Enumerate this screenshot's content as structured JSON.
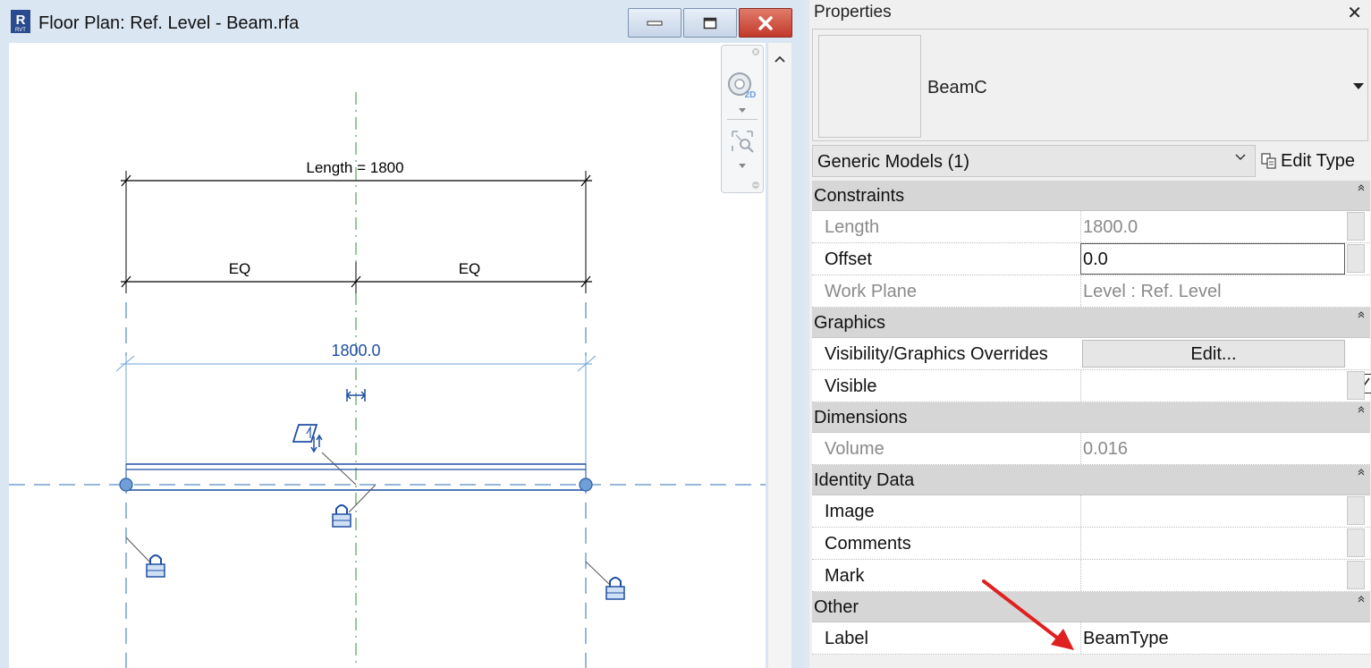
{
  "window": {
    "title": "Floor Plan: Ref. Level - Beam.rfa",
    "app_icon_letters": "R",
    "app_icon_sub": "RVT",
    "minimize_icon": "minimize-icon",
    "maximize_icon": "maximize-icon",
    "close_icon": "close-icon"
  },
  "drawing": {
    "length_dim": "Length = 1800",
    "eq_left": "EQ",
    "eq_right": "EQ",
    "temp_dim": "1800.0"
  },
  "navbar": {
    "steering_badge": "2D",
    "zoom_icon": "zoom-region-icon"
  },
  "properties": {
    "title": "Properties",
    "close_glyph": "✕",
    "type_name": "BeamC",
    "filter": "Generic Models (1)",
    "edit_type": "Edit Type",
    "sections": {
      "constraints": "Constraints",
      "graphics": "Graphics",
      "dimensions": "Dimensions",
      "identity": "Identity Data",
      "other": "Other"
    },
    "rows": {
      "length": {
        "name": "Length",
        "value": "1800.0"
      },
      "offset": {
        "name": "Offset",
        "value": "0.0"
      },
      "work_plane": {
        "name": "Work Plane",
        "value": "Level : Ref. Level"
      },
      "vg_overrides": {
        "name": "Visibility/Graphics Overrides",
        "value": "Edit..."
      },
      "visible": {
        "name": "Visible",
        "checked": true
      },
      "volume": {
        "name": "Volume",
        "value": "0.016"
      },
      "image": {
        "name": "Image",
        "value": ""
      },
      "comments": {
        "name": "Comments",
        "value": ""
      },
      "mark": {
        "name": "Mark",
        "value": ""
      },
      "label": {
        "name": "Label",
        "value": "BeamType"
      }
    }
  },
  "colors": {
    "dim_blue": "#1f4fa3",
    "ref_plane_green": "#2f8f3a",
    "ref_plane_blue": "#2f6fb0",
    "annotation_red": "#e02020",
    "close_red": "#c3392a"
  }
}
